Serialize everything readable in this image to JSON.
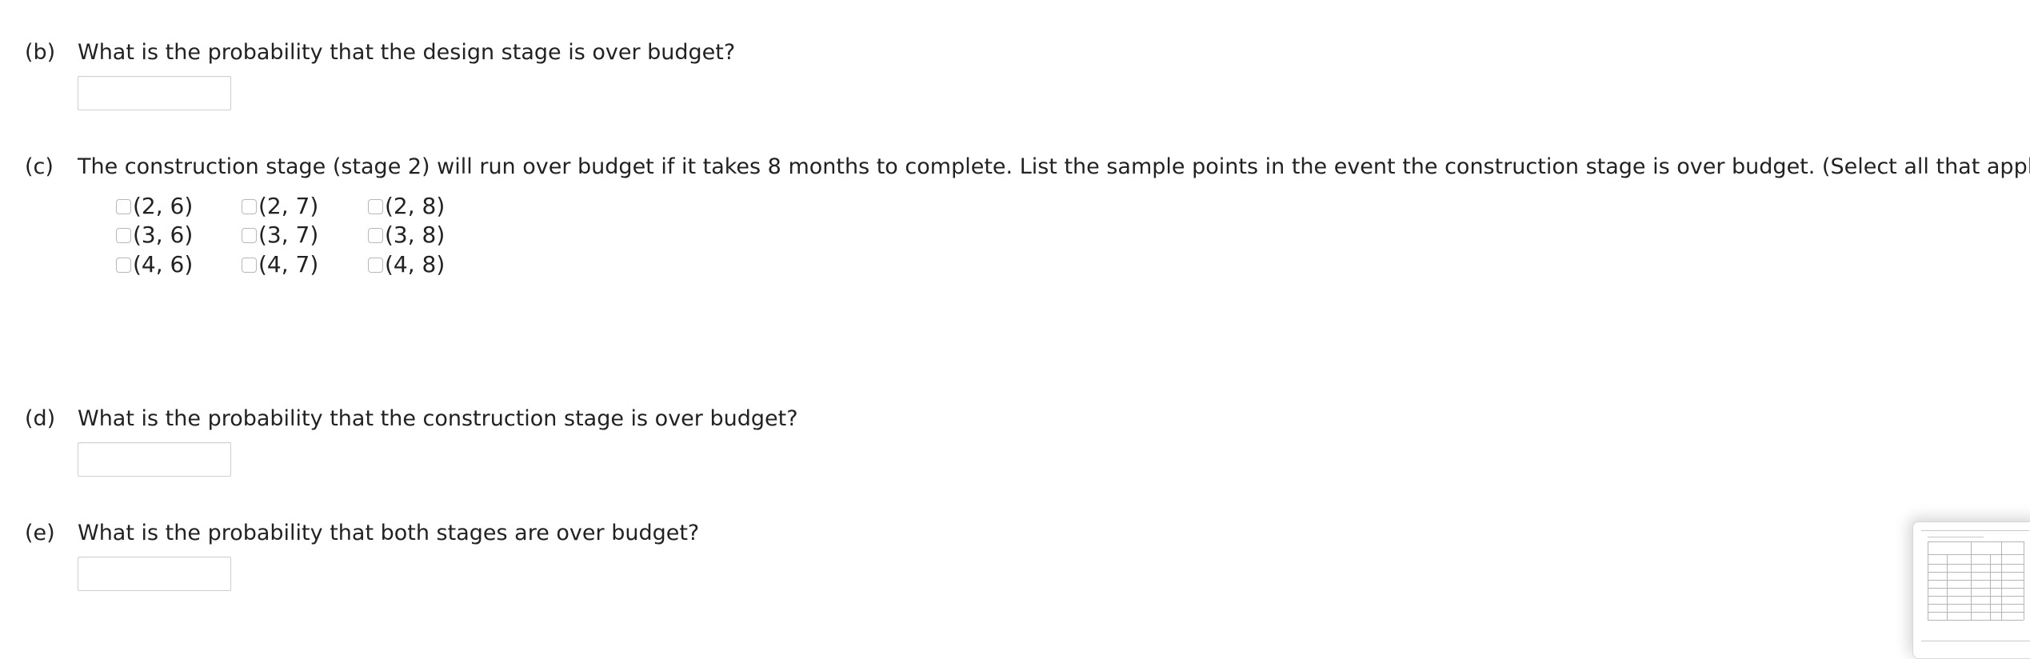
{
  "questions": {
    "b": {
      "label": "(b)",
      "text": "What is the probability that the design stage is over budget?"
    },
    "c": {
      "label": "(c)",
      "text": "The construction stage (stage 2) will run over budget if it takes 8 months to complete. List the sample points in the event the construction stage is over budget. (Select all that apply.)",
      "options": [
        [
          "(2, 6)",
          "(2, 7)",
          "(2, 8)"
        ],
        [
          "(3, 6)",
          "(3, 7)",
          "(3, 8)"
        ],
        [
          "(4, 6)",
          "(4, 7)",
          "(4, 8)"
        ]
      ]
    },
    "d": {
      "label": "(d)",
      "text": "What is the probability that the construction stage is over budget?"
    },
    "e": {
      "label": "(e)",
      "text": "What is the probability that both stages are over budget?"
    }
  },
  "answers": {
    "b": "",
    "d": "",
    "e": ""
  },
  "colors": {
    "text": "#222222",
    "input_border": "#cfcfcf",
    "checkbox_border": "#b8b8b8",
    "background": "#ffffff"
  }
}
